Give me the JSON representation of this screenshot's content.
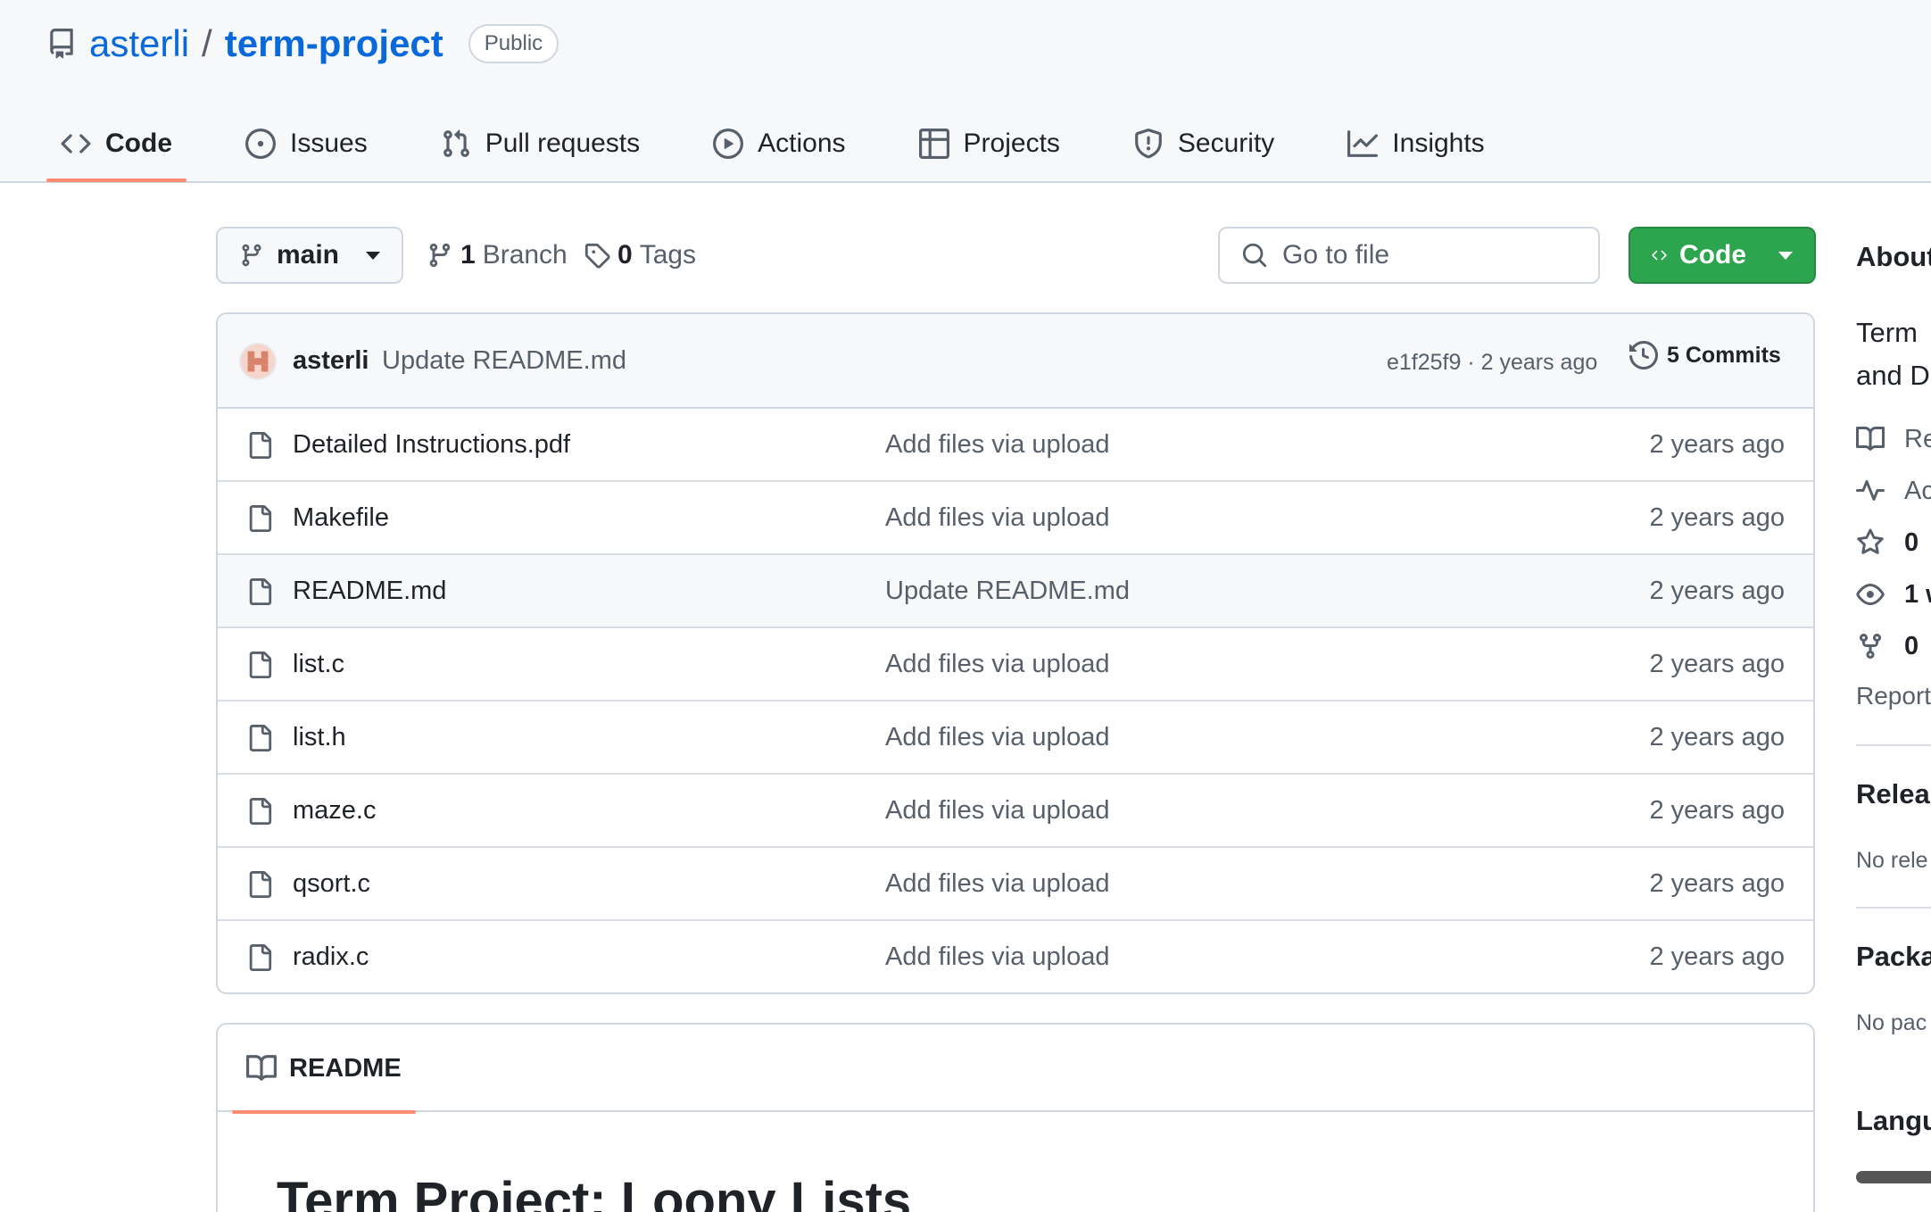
{
  "repo": {
    "owner": "asterli",
    "separator": "/",
    "name": "term-project",
    "visibility": "Public"
  },
  "nav": {
    "tabs": [
      {
        "label": "Code",
        "icon": "code-icon",
        "active": true
      },
      {
        "label": "Issues",
        "icon": "issue-opened-icon"
      },
      {
        "label": "Pull requests",
        "icon": "git-pull-request-icon"
      },
      {
        "label": "Actions",
        "icon": "play-icon"
      },
      {
        "label": "Projects",
        "icon": "table-icon"
      },
      {
        "label": "Security",
        "icon": "shield-icon"
      },
      {
        "label": "Insights",
        "icon": "graph-icon"
      }
    ]
  },
  "toolbar": {
    "branch": "main",
    "branch_count": "1",
    "branch_label": "Branch",
    "tag_count": "0",
    "tag_label": "Tags",
    "search_placeholder": "Go to file",
    "code_button": "Code"
  },
  "latest_commit": {
    "author": "asterli",
    "message": "Update README.md",
    "meta": "e1f25f9 · 2 years ago",
    "commits_label": "5 Commits"
  },
  "files": [
    {
      "name": "Detailed Instructions.pdf",
      "commit": "Add files via upload",
      "age": "2 years ago"
    },
    {
      "name": "Makefile",
      "commit": "Add files via upload",
      "age": "2 years ago"
    },
    {
      "name": "README.md",
      "commit": "Update README.md",
      "age": "2 years ago"
    },
    {
      "name": "list.c",
      "commit": "Add files via upload",
      "age": "2 years ago"
    },
    {
      "name": "list.h",
      "commit": "Add files via upload",
      "age": "2 years ago"
    },
    {
      "name": "maze.c",
      "commit": "Add files via upload",
      "age": "2 years ago"
    },
    {
      "name": "qsort.c",
      "commit": "Add files via upload",
      "age": "2 years ago"
    },
    {
      "name": "radix.c",
      "commit": "Add files via upload",
      "age": "2 years ago"
    }
  ],
  "readme": {
    "tab_label": "README",
    "title": "Term Project: Loony Lists"
  },
  "sidebar": {
    "about_heading": "About",
    "description_line1": "Term",
    "description_line2": "and D",
    "readme_item": "Re",
    "activity_item": "Ac",
    "stars": "0",
    "watchers": "1 w",
    "forks": "0",
    "report": "Report",
    "releases_heading": "Relea",
    "releases_text": "No rele",
    "packages_heading": "Packa",
    "packages_text": "No pac",
    "languages_heading": "Langu"
  },
  "colors": {
    "accent_link": "#0969da",
    "tab_underline": "#fd8c73",
    "code_button": "#2da44e"
  }
}
